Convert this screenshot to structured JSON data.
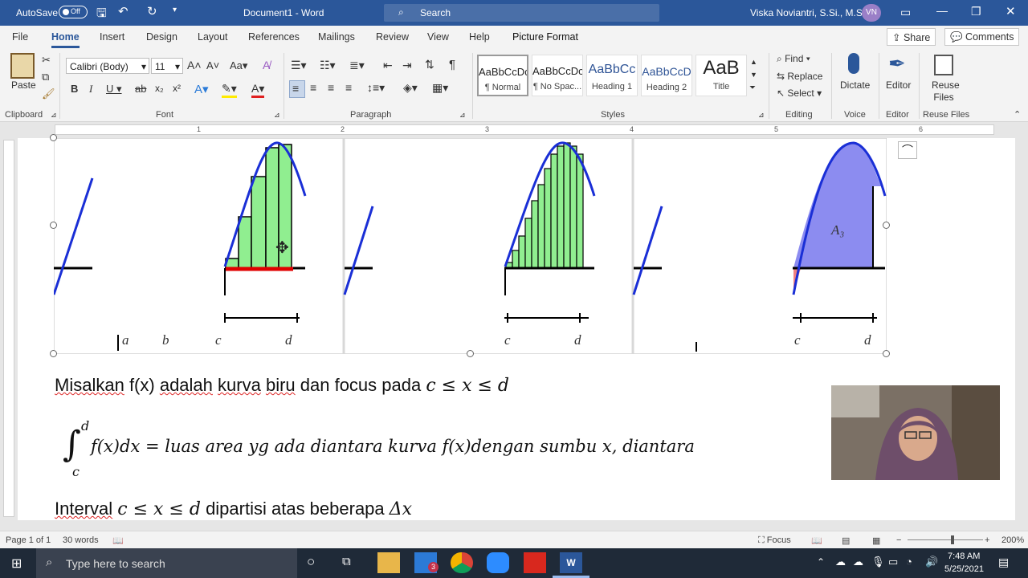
{
  "titlebar": {
    "autosave": "AutoSave",
    "autosave_state": "Off",
    "title": "Document1 - Word",
    "search": "Search",
    "user": "Viska Noviantri, S.Si., M.Si.",
    "initials": "VN"
  },
  "tabs": [
    "File",
    "Home",
    "Insert",
    "Design",
    "Layout",
    "References",
    "Mailings",
    "Review",
    "View",
    "Help",
    "Picture Format"
  ],
  "share": "Share",
  "comments": "Comments",
  "ribbon": {
    "paste": "Paste",
    "font_name": "Calibri (Body)",
    "font_size": "11",
    "styles": [
      {
        "preview": "AaBbCcDc",
        "name": "¶ Normal"
      },
      {
        "preview": "AaBbCcDc",
        "name": "¶ No Spac..."
      },
      {
        "preview": "AaBbCc",
        "name": "Heading 1"
      },
      {
        "preview": "AaBbCcD",
        "name": "Heading 2"
      },
      {
        "preview": "AaB",
        "name": "Title"
      }
    ],
    "find": "Find",
    "replace": "Replace",
    "select": "Select",
    "dictate": "Dictate",
    "editor": "Editor",
    "reuse": "Reuse Files",
    "groups": {
      "clipboard": "Clipboard",
      "font": "Font",
      "paragraph": "Paragraph",
      "styles": "Styles",
      "editing": "Editing",
      "voice": "Voice",
      "editor": "Editor",
      "reuse": "Reuse Files"
    }
  },
  "ruler": [
    "1",
    "2",
    "3",
    "4",
    "5",
    "6"
  ],
  "figure": {
    "labels1": [
      "a",
      "b",
      "c",
      "d"
    ],
    "labels2": [
      "c",
      "d"
    ],
    "labels3": [
      "c",
      "d"
    ],
    "area_label": "A₃"
  },
  "doc": {
    "line1a": "Misalkan",
    "line1b": "f(x)",
    "line1c": "adalah",
    "line1d": "kurva",
    "line1e": "biru",
    "line1f": "dan focus pada",
    "line1m": "c ≤ x ≤ d",
    "int_upper": "d",
    "int_lower": "c",
    "int_body": "f(x)dx = luas area yg ada diantara kurva f(x)dengan sumbu x, diantara",
    "line3a": "Interval",
    "line3m": "c ≤ x ≤ d",
    "line3b": "dipartisi atas beberapa",
    "line3c": "Δx"
  },
  "status": {
    "page": "Page 1 of 1",
    "words": "30 words",
    "focus": "Focus",
    "zoom": "200%"
  },
  "taskbar": {
    "search": "Type here to search",
    "time": "7:48 AM",
    "date": "5/25/2021",
    "mail_badge": "3"
  }
}
